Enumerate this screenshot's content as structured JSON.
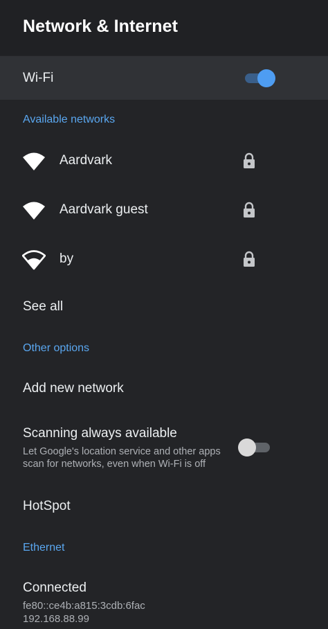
{
  "header": {
    "title": "Network & Internet"
  },
  "wifi": {
    "label": "Wi-Fi",
    "enabled": true
  },
  "available_networks": {
    "heading": "Available networks",
    "items": [
      {
        "name": "Aardvark",
        "secured": true,
        "signal": "full"
      },
      {
        "name": "Aardvark guest",
        "secured": true,
        "signal": "full"
      },
      {
        "name": "by",
        "secured": true,
        "signal": "medium"
      }
    ],
    "see_all": "See all"
  },
  "other_options": {
    "heading": "Other options",
    "add_network": "Add new network",
    "scanning": {
      "title": "Scanning always available",
      "description_line1": "Let Google's location service and other apps",
      "description_line2": "scan for networks, even when Wi-Fi is off",
      "enabled": false
    },
    "hotspot": "HotSpot"
  },
  "ethernet": {
    "heading": "Ethernet",
    "status": "Connected",
    "ipv6": "fe80::ce4b:a815:3cdb:6fac",
    "ipv4": "192.168.88.99"
  },
  "colors": {
    "background": "#232427",
    "accent": "#5aa7f0",
    "toggle_on_knob": "#4e9df2",
    "toggle_on_track": "#3a5f8a",
    "toggle_off_knob": "#d9d9d9",
    "toggle_off_track": "#5f6368"
  },
  "icons": {
    "wifi": "wifi-icon",
    "lock": "lock-icon"
  }
}
